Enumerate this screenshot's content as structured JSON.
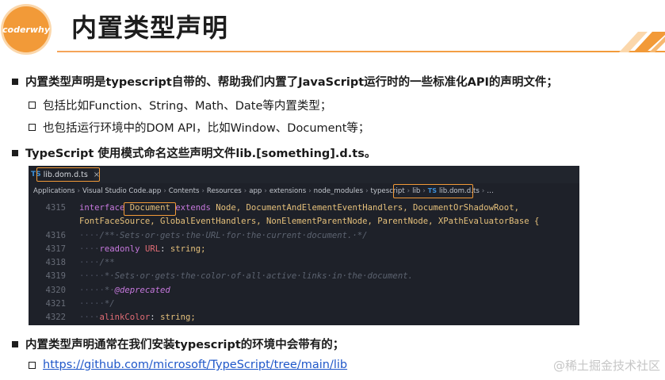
{
  "header": {
    "logo_text": "coderwhy",
    "title": "内置类型声明"
  },
  "bullets": [
    {
      "text": "内置类型声明是typescript自带的、帮助我们内置了JavaScript运行时的一些标准化API的声明文件；"
    },
    {
      "text": "包括比如Function、String、Math、Date等内置类型；"
    },
    {
      "text": "也包括运行环境中的DOM API，比如Window、Document等；"
    },
    {
      "text": "TypeScript 使用模式命名这些声明文件lib.[something].d.ts。"
    },
    {
      "text": "内置类型声明通常在我们安装typescript的环境中会带有的；"
    },
    {
      "text": "https://github.com/microsoft/TypeScript/tree/main/lib"
    }
  ],
  "editor": {
    "tab_badge": "TS",
    "tab_name": "lib.dom.d.ts",
    "tab_close": "×",
    "breadcrumbs": [
      "Applications",
      "Visual Studio Code.app",
      "Contents",
      "Resources",
      "app",
      "extensions",
      "node_modules",
      "typescript",
      "lib",
      "lib.dom.d.ts",
      "…"
    ],
    "crumb_ts_badge": "TS",
    "crumb_sep": "›",
    "lines": {
      "l4315": {
        "num": "4315",
        "kw": "interface",
        "name": "Document",
        "ext": "extends",
        "rest": "Node, DocumentAndElementEventHandlers, DocumentOrShadowRoot,"
      },
      "l4315b": {
        "num": "",
        "text": "FontFaceSource, GlobalEventHandlers, NonElementParentNode, ParentNode, XPathEvaluatorBase {"
      },
      "l4316": {
        "num": "4316",
        "indent": "····",
        "comment": "/**·Sets·or·gets·the·URL·for·the·current·document.·*/"
      },
      "l4317": {
        "num": "4317",
        "indent": "····",
        "kw": "readonly",
        "name": "URL",
        "sep": ":",
        "type": "string;"
      },
      "l4318": {
        "num": "4318",
        "indent": "····",
        "comment": "/**"
      },
      "l4319": {
        "num": "4319",
        "indent": "·····",
        "comment": "*·Sets·or·gets·the·color·of·all·active·links·in·the·document."
      },
      "l4320": {
        "num": "4320",
        "indent": "·····",
        "comment": "*·",
        "tag": "@deprecated"
      },
      "l4321": {
        "num": "4321",
        "indent": "·····",
        "comment": "*/"
      },
      "l4322": {
        "num": "4322",
        "indent": "····",
        "name": "alinkColor",
        "sep": ":",
        "type": "string;"
      }
    }
  },
  "watermark": "@稀土掘金技术社区",
  "colors": {
    "accent": "#f29a38",
    "link": "#1f57c9"
  }
}
